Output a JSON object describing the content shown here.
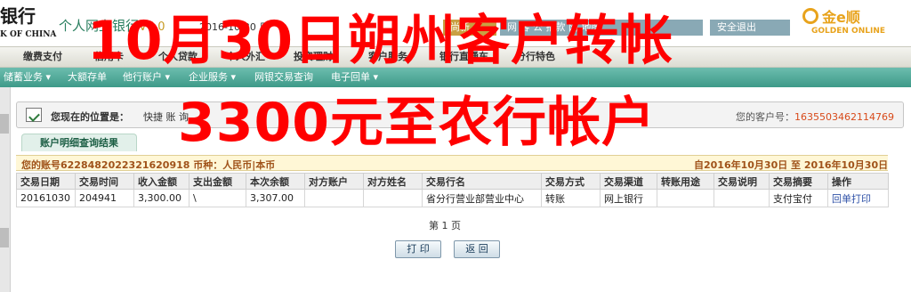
{
  "header": {
    "bank_name_cn": "银行",
    "bank_name_en": "K OF CHINA",
    "product_name": "个人网上银行",
    "version": "V6.0",
    "date": "2016-10-30 日",
    "trial_link": "尚新",
    "nav_links": "网 客 公 捐款 网 地图",
    "logout_link": "安全退出",
    "golden_logo_name": "金e顺",
    "golden_logo_sub": "GOLDEN ONLINE"
  },
  "menu_primary": [
    "缴费支付",
    "信用卡",
    "个人贷款",
    "个人外汇",
    "投资理财",
    "客户服务",
    "银行直通车",
    "分行特色"
  ],
  "menu_secondary": [
    "储蓄业务 ▾",
    "大额存单",
    "他行账户 ▾",
    "企业服务 ▾",
    "网银交易查询",
    "电子回单 ▾"
  ],
  "location": {
    "label": "您现在的位置是：",
    "path": "快捷 账 询",
    "customer_no_label": "您的客户号：",
    "customer_no": "1635503462114769"
  },
  "tab_title": "账户明细查询结果",
  "account_bar": {
    "left": "您的账号6228482022321620918 币种：人民币|本币",
    "right": "自2016年10月30日  至  2016年10月30日"
  },
  "table": {
    "headers": [
      "交易日期",
      "交易时间",
      "收入金额",
      "支出金额",
      "本次余额",
      "对方账户",
      "对方姓名",
      "交易行名",
      "交易方式",
      "交易渠道",
      "转账用途",
      "交易说明",
      "交易摘要",
      "操作"
    ],
    "rows": [
      [
        "20161030",
        "204941",
        "3,300.00",
        "\\",
        "3,307.00",
        "",
        "",
        "省分行营业部营业中心",
        "转账",
        "网上银行",
        "",
        "",
        "支付宝付",
        "回单打印"
      ]
    ]
  },
  "pagination": "第 1 页",
  "buttons": {
    "print": "打 印",
    "back": "返 回"
  },
  "overlay_text": {
    "line1": "10月30日朔州客户转帐",
    "line2": "3300元至农行帐户"
  },
  "colors": {
    "menu_teal": "#3e9a89",
    "overlay_red": "#ff0000",
    "customer_no_orange": "#d84a1a",
    "account_bar_bg": "#fff7d6",
    "golden_logo": "#e8a31c"
  }
}
